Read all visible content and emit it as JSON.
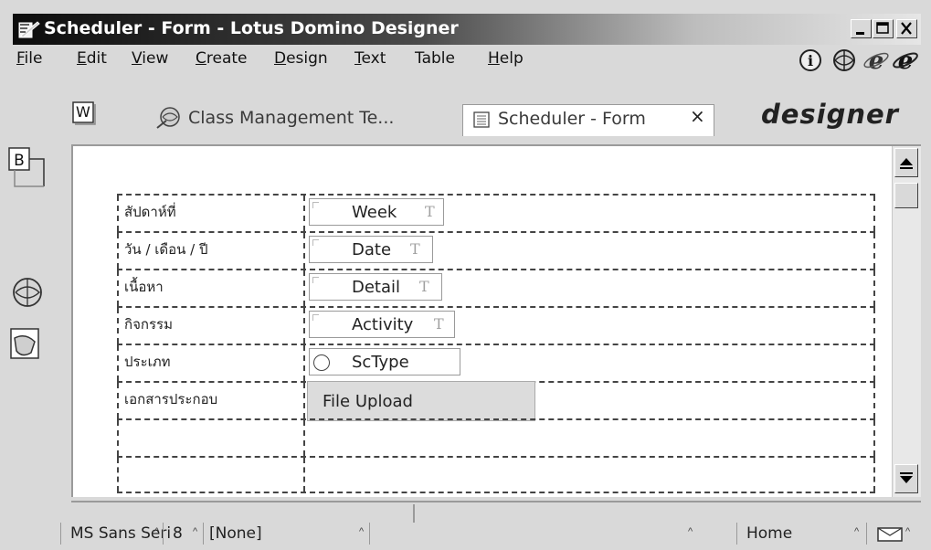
{
  "window": {
    "title": "Scheduler - Form - Lotus Domino Designer"
  },
  "menu": {
    "items": [
      {
        "label": "File",
        "ul": "F",
        "rest": "ile"
      },
      {
        "label": "Edit",
        "ul": "E",
        "rest": "dit"
      },
      {
        "label": "View",
        "ul": "V",
        "rest": "iew"
      },
      {
        "label": "Create",
        "ul": "C",
        "rest": "reate"
      },
      {
        "label": "Design",
        "ul": "D",
        "rest": "esign"
      },
      {
        "label": "Text",
        "ul": "T",
        "rest": "ext"
      },
      {
        "label": "Table",
        "ul": "",
        "rest": "Table"
      },
      {
        "label": "Help",
        "ul": "H",
        "rest": "elp"
      }
    ],
    "icons": [
      "info-icon",
      "domino-globe-icon",
      "internet-explorer-icon",
      "internet-explorer-icon-2"
    ]
  },
  "tabs": {
    "workspace_icon": "W",
    "items": [
      {
        "label": "Class Management Te...",
        "icon": "database-icon"
      },
      {
        "label": "Scheduler - Form",
        "icon": "form-icon",
        "active": true
      }
    ],
    "close_glyph": "×",
    "brand": "designer"
  },
  "bookmarks": {
    "b_label": "B"
  },
  "form": {
    "rows": [
      {
        "label": "สัปดาห์ที่",
        "field": "Week",
        "type": "text"
      },
      {
        "label": "วัน / เดือน / ปี",
        "field": "Date",
        "type": "text"
      },
      {
        "label": "เนื้อหา",
        "field": "Detail",
        "type": "text"
      },
      {
        "label": "กิจกรรม",
        "field": "Activity",
        "type": "text"
      },
      {
        "label": "ประเภท",
        "field": "ScType",
        "type": "radio"
      },
      {
        "label": "เอกสารประกอบ",
        "field": "File Upload",
        "type": "upload"
      },
      {
        "label": "",
        "field": "",
        "type": "empty"
      },
      {
        "label": "",
        "field": "",
        "type": "empty"
      }
    ],
    "text_marker": "T"
  },
  "statusbar": {
    "font": "MS Sans Seri",
    "size": "8",
    "style": "[None]",
    "location": "Home"
  },
  "colors": {
    "chrome": "#d9d9d9",
    "title_start": "#0c0c0c",
    "title_end": "#e6e6e6",
    "dashed": "#444444"
  }
}
